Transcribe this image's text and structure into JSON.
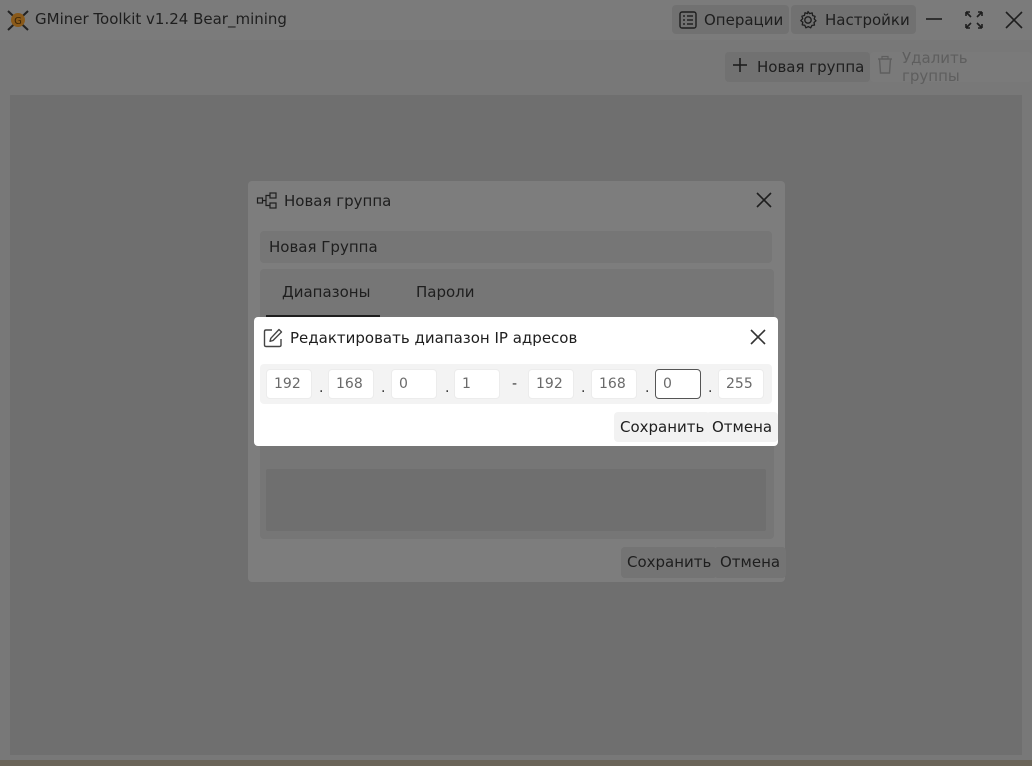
{
  "app": {
    "title": "GMiner Toolkit v1.24 Bear_mining",
    "operations_label": "Операции",
    "settings_label": "Настройки"
  },
  "toolbar": {
    "new_group_label": "Новая группа",
    "delete_groups_label": "Удалить группы"
  },
  "outer_dialog": {
    "title": "Новая группа",
    "name_value": "Новая Группа",
    "tabs": [
      {
        "label": "Диапазоны",
        "active": true
      },
      {
        "label": "Пароли",
        "active": false
      }
    ],
    "save_label": "Сохранить",
    "cancel_label": "Отмена"
  },
  "inner_dialog": {
    "title": "Редактировать диапазон IP адресов",
    "start_ip": [
      "192",
      "168",
      "0",
      "1"
    ],
    "range_separator": "-",
    "end_ip": [
      "192",
      "168",
      "0",
      "255"
    ],
    "focused_field": "end_ip_octet_3",
    "save_label": "Сохранить",
    "cancel_label": "Отмена"
  },
  "colors": {
    "overlay_dim": "#787878",
    "dialog_bg": "#ffffff",
    "text": "#1e1e1e",
    "logo_orange": "#e08a1e"
  },
  "icons": [
    "app-logo-icon",
    "operations-list-icon",
    "settings-gear-icon",
    "minimize-icon",
    "maximize-icon",
    "close-icon",
    "plus-icon",
    "trash-icon",
    "group-tree-icon",
    "edit-icon"
  ]
}
